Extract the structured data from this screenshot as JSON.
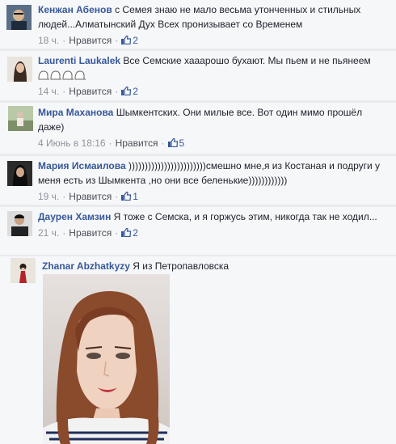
{
  "comments": [
    {
      "name": "Кенжан Абенов",
      "text": "с Семея знаю не мало весьма утонченных и стильных людей...Алматынский Дух Всех пронизывает со Временем",
      "time": "18 ч.",
      "like_label": "Нравится",
      "likes": "2"
    },
    {
      "name": "Laurenti Laukalek",
      "text": "Все Семские хааарошо бухают. Мы пьем и не пьянеем",
      "time": "14 ч.",
      "like_label": "Нравится",
      "likes": "2"
    },
    {
      "name": "Мира Маханова",
      "text": "Шымкентских. Они милые все. Вот один мимо прошёл даже)",
      "time": "4 Июнь в 18:16",
      "like_label": "Нравится",
      "likes": "5"
    },
    {
      "name": "Мария Исмаилова",
      "text": "))))))))))))))))))))))))смешно мне,я из Костаная и подруги у меня есть из Шымкента ,но они все беленькие))))))))))))",
      "time": "19 ч.",
      "like_label": "Нравится",
      "likes": "1"
    },
    {
      "name": "Даурен Хамзин",
      "text": "Я тоже с Семска, и я горжусь этим, никогда так не ходил...",
      "time": "21 ч.",
      "like_label": "Нравится",
      "likes": "2"
    },
    {
      "name": "Zhanar Abzhatkyzy",
      "text": "Я из Петропавловска"
    }
  ],
  "icons": {
    "like": "thumbs-up-icon",
    "emoji": "emoji-icon"
  },
  "colors": {
    "name": "#365899",
    "meta": "#90949c",
    "background": "#f6f7f9"
  }
}
